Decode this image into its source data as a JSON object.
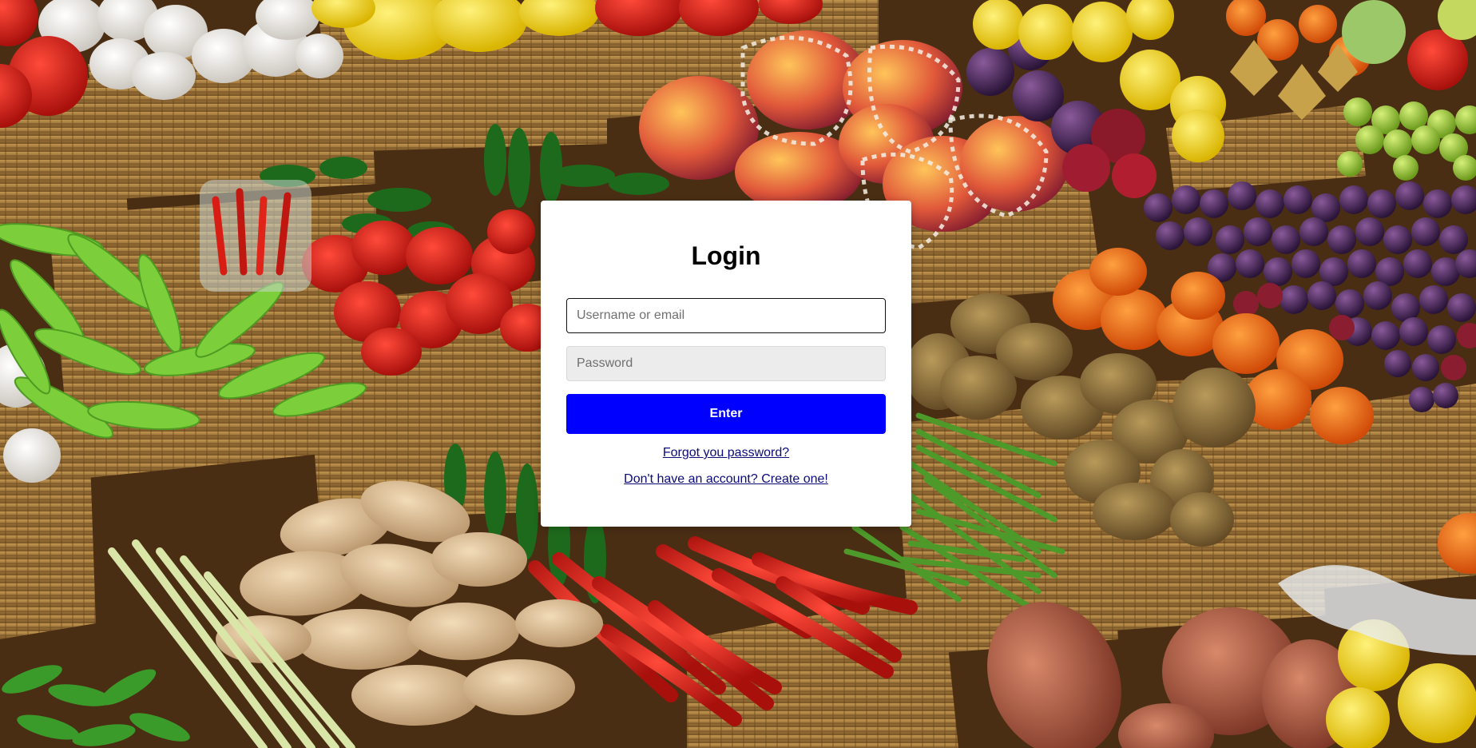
{
  "background": {
    "description_icon": "market-produce-photo"
  },
  "login": {
    "title": "Login",
    "username_placeholder": "Username or email",
    "username_value": "",
    "password_placeholder": "Password",
    "password_value": "",
    "enter_label": "Enter",
    "forgot_label": "Forgot you password?",
    "create_label": "Don't have an account? Create one!"
  },
  "colors": {
    "enter_button": "#0000ff",
    "link": "#0b0b7a",
    "card": "#ffffff"
  }
}
